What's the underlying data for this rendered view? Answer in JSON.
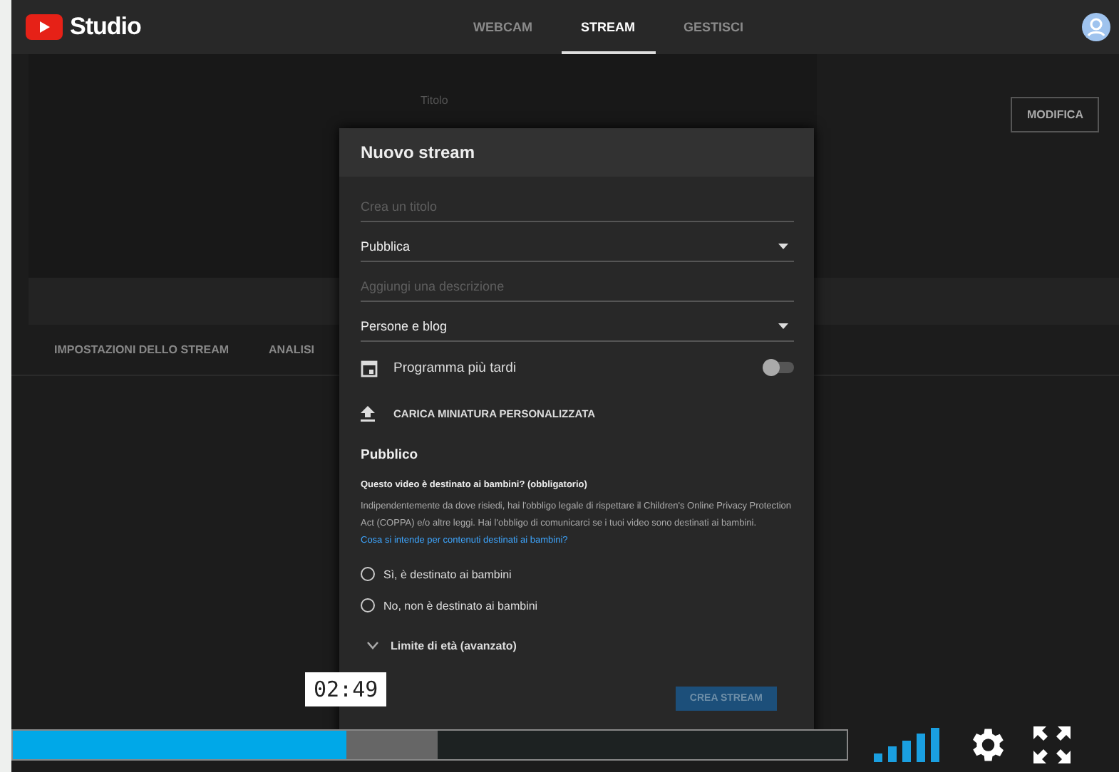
{
  "header": {
    "logo_text": "Studio",
    "tabs": [
      {
        "label": "WEBCAM",
        "selected": false
      },
      {
        "label": "STREAM",
        "selected": true
      },
      {
        "label": "GESTISCI",
        "selected": false
      }
    ]
  },
  "background": {
    "title_label": "Titolo",
    "edit_button": "MODIFICA",
    "tabs": [
      {
        "label": "IMPOSTAZIONI DELLO STREAM"
      },
      {
        "label": "ANALISI"
      }
    ]
  },
  "dialog": {
    "title": "Nuovo stream",
    "fields": [
      {
        "kind": "text",
        "placeholder": "Crea un titolo"
      },
      {
        "kind": "select",
        "value": "Pubblica"
      },
      {
        "kind": "text",
        "placeholder": "Aggiungi una descrizione"
      },
      {
        "kind": "select",
        "value": "Persone e blog"
      }
    ],
    "schedule": {
      "label": "Programma più tardi",
      "on": false
    },
    "upload_label": "CARICA MINIATURA PERSONALIZZATA",
    "audience": {
      "heading": "Pubblico",
      "question": "Questo video è destinato ai bambini? (obbligatorio)",
      "body": "Indipendentemente da dove risiedi, hai l'obbligo legale di rispettare il Children's Online Privacy Protection Act (COPPA) e/o altre leggi. Hai l'obbligo di comunicarci se i tuoi video sono destinati ai bambini.",
      "link": "Cosa si intende per contenuti destinati ai bambini?",
      "options": [
        {
          "label": "Sì, è destinato ai bambini",
          "selected": false
        },
        {
          "label": "No, non è destinato ai bambini",
          "selected": false
        }
      ]
    },
    "age_limit": {
      "label": "Limite di età (avanzato)",
      "expanded": false
    },
    "create_button": "CREA STREAM"
  },
  "player": {
    "time": "02:49",
    "progress": {
      "level": 0.4
    },
    "buffer": {
      "level": 0.51
    }
  }
}
